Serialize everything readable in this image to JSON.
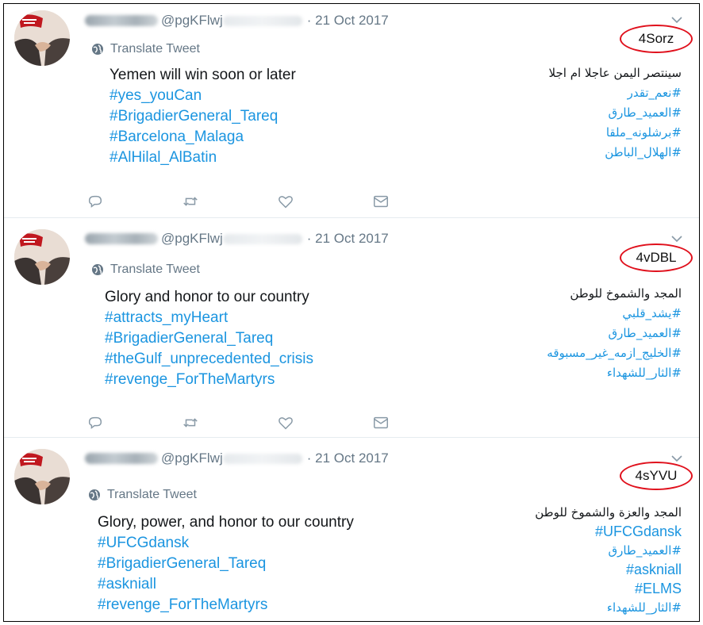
{
  "tweets": [
    {
      "handle": "@pgKFlwj",
      "sep": "·",
      "date": "21 Oct 2017",
      "badge": "4Sorz",
      "translate": "Translate Tweet",
      "en_lines": [
        "Yemen will win soon or later",
        "#yes_youCan",
        "#BrigadierGeneral_Tareq",
        "#Barcelona_Malaga",
        "#AlHilal_AlBatin"
      ],
      "ar_lines": [
        "سينتصر اليمن عاجلا ام اجلا",
        "#نعم_تقدر",
        "#العميد_طارق",
        "#برشلونه_ملقا",
        "#الهلال_الباطن"
      ]
    },
    {
      "handle": "@pgKFlwj",
      "sep": "·",
      "date": "21 Oct 2017",
      "badge": "4vDBL",
      "translate": "Translate Tweet",
      "en_lines": [
        "Glory and honor to our country",
        "#attracts_myHeart",
        "#BrigadierGeneral_Tareq",
        "#theGulf_unprecedented_crisis",
        "#revenge_ForTheMartyrs"
      ],
      "ar_lines": [
        "المجد والشموخ للوطن",
        "#يشد_قلبي",
        "#العميد_طارق",
        "#الخليج_ازمه_غير_مسبوقه",
        "#الثار_للشهداء"
      ]
    },
    {
      "handle": "@pgKFlwj",
      "sep": "·",
      "date": "21 Oct 2017",
      "badge": "4sYVU",
      "translate": "Translate Tweet",
      "en_lines": [
        "Glory, power, and honor to our country",
        "#UFCGdansk",
        "#BrigadierGeneral_Tareq",
        "#askniall",
        "#revenge_ForTheMartyrs"
      ],
      "ar_lines": [
        "المجد والعزة والشموخ للوطن",
        "#UFCGdansk",
        "#العميد_طارق",
        "#askniall",
        "#ELMS",
        "#الثار_للشهداء"
      ]
    }
  ],
  "icons": [
    "avatar",
    "chevron-down-icon",
    "globe-icon",
    "reply-icon",
    "retweet-icon",
    "like-icon",
    "message-icon"
  ],
  "colors": {
    "hashtag": "#1b95e0",
    "muted": "#657786",
    "badge_ring": "#e0101c"
  }
}
